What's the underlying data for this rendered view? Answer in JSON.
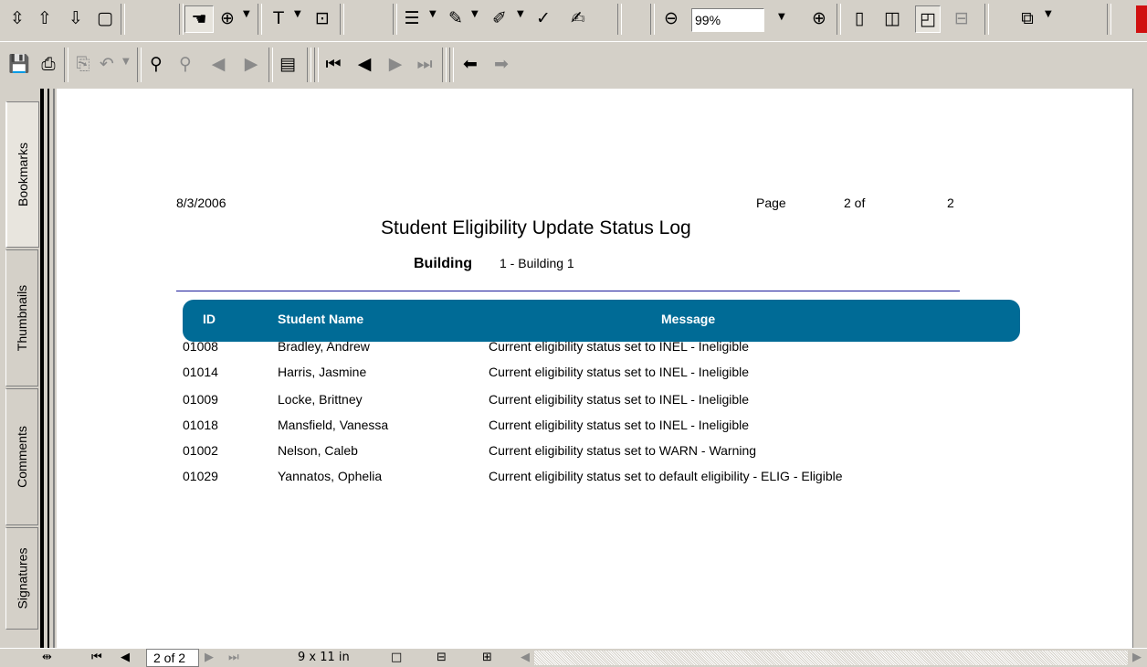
{
  "toolbar1": {
    "zoom_value": "99%"
  },
  "sidebar": {
    "tabs": [
      {
        "label": "Bookmarks"
      },
      {
        "label": "Thumbnails"
      },
      {
        "label": "Comments"
      },
      {
        "label": "Signatures"
      }
    ]
  },
  "report": {
    "date": "8/3/2006",
    "page_label": "Page",
    "page_of": "2 of",
    "page_total": "2",
    "title": "Student Eligibility Update Status Log",
    "building_label": "Building",
    "building_value": "1 - Building 1",
    "columns": {
      "id": "ID",
      "name": "Student Name",
      "message": "Message"
    },
    "rows": [
      {
        "id": "01008",
        "name": "Bradley, Andrew",
        "message": "Current eligibility status set to INEL - Ineligible"
      },
      {
        "id": "01014",
        "name": "Harris, Jasmine",
        "message": "Current eligibility status set to INEL - Ineligible"
      },
      {
        "id": "01009",
        "name": "Locke, Brittney",
        "message": "Current eligibility status set to INEL - Ineligible"
      },
      {
        "id": "01018",
        "name": "Mansfield, Vanessa",
        "message": "Current eligibility status set to INEL - Ineligible"
      },
      {
        "id": "01002",
        "name": "Nelson, Caleb",
        "message": "Current eligibility status set to WARN - Warning"
      },
      {
        "id": "01029",
        "name": "Yannatos, Ophelia",
        "message": "Current eligibility status set to default eligibility - ELIG - Eligible"
      }
    ]
  },
  "statusbar": {
    "page_indicator": "2 of 2",
    "page_size": "9 x 11 in"
  },
  "colors": {
    "header_band": "#006b96",
    "toolbar_bg": "#d4d0c8"
  }
}
